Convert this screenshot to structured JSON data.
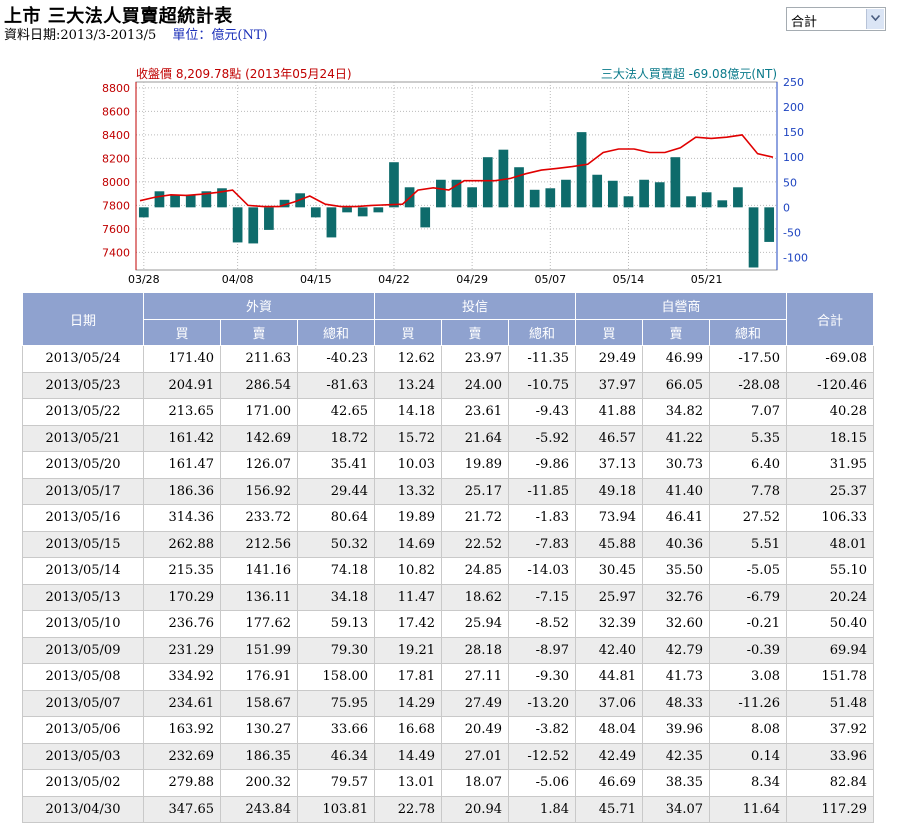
{
  "page": {
    "title": "上市 三大法人買賣超統計表",
    "date_label": "資料日期:2013/3-2013/5",
    "unit_label": "單位：億元(NT)",
    "select_value": "合計"
  },
  "chart_data": {
    "type": "bar+line",
    "price_label": "收盤價 8,209.78點 (2013年05月24日)",
    "net_label": "三大法人買賣超 -69.08億元(NT)",
    "left_ticks": [
      8800,
      8600,
      8400,
      8200,
      8000,
      7800,
      7600,
      7400
    ],
    "right_ticks": [
      250,
      200,
      150,
      100,
      50,
      0,
      -50,
      -100
    ],
    "left_ylim": [
      7250,
      8850
    ],
    "right_ylim": [
      -125,
      250
    ],
    "x_ticks": [
      {
        "label": "03/28",
        "index": 0
      },
      {
        "label": "04/08",
        "index": 6
      },
      {
        "label": "04/15",
        "index": 11
      },
      {
        "label": "04/22",
        "index": 16
      },
      {
        "label": "04/29",
        "index": 21
      },
      {
        "label": "05/07",
        "index": 26
      },
      {
        "label": "05/14",
        "index": 31
      },
      {
        "label": "05/21",
        "index": 36
      }
    ],
    "bars": [
      -20,
      32,
      25,
      25,
      32,
      38,
      -70,
      -72,
      -45,
      15,
      28,
      -20,
      -60,
      -10,
      -18,
      -10,
      90,
      40,
      -40,
      55,
      55,
      40,
      100,
      115,
      80,
      35,
      38,
      55,
      150,
      65,
      53,
      22,
      55,
      50,
      100,
      22,
      30,
      14,
      40,
      -120,
      -69
    ],
    "price": [
      7840,
      7870,
      7890,
      7885,
      7895,
      7910,
      7930,
      7800,
      7790,
      7790,
      7830,
      7880,
      7810,
      7790,
      7790,
      7800,
      7805,
      7810,
      7930,
      7950,
      7930,
      8010,
      8010,
      8010,
      8030,
      8070,
      8100,
      8115,
      8130,
      8150,
      8250,
      8280,
      8280,
      8250,
      8250,
      8290,
      8380,
      8370,
      8380,
      8400,
      8240,
      8210
    ]
  },
  "table": {
    "header_top": [
      "日期",
      "外資",
      "投信",
      "自營商",
      "合計"
    ],
    "header_sub": [
      "買",
      "賣",
      "總和",
      "買",
      "賣",
      "總和",
      "買",
      "賣",
      "總和"
    ],
    "rows": [
      [
        "2013/05/24",
        "171.40",
        "211.63",
        "-40.23",
        "12.62",
        "23.97",
        "-11.35",
        "29.49",
        "46.99",
        "-17.50",
        "-69.08"
      ],
      [
        "2013/05/23",
        "204.91",
        "286.54",
        "-81.63",
        "13.24",
        "24.00",
        "-10.75",
        "37.97",
        "66.05",
        "-28.08",
        "-120.46"
      ],
      [
        "2013/05/22",
        "213.65",
        "171.00",
        "42.65",
        "14.18",
        "23.61",
        "-9.43",
        "41.88",
        "34.82",
        "7.07",
        "40.28"
      ],
      [
        "2013/05/21",
        "161.42",
        "142.69",
        "18.72",
        "15.72",
        "21.64",
        "-5.92",
        "46.57",
        "41.22",
        "5.35",
        "18.15"
      ],
      [
        "2013/05/20",
        "161.47",
        "126.07",
        "35.41",
        "10.03",
        "19.89",
        "-9.86",
        "37.13",
        "30.73",
        "6.40",
        "31.95"
      ],
      [
        "2013/05/17",
        "186.36",
        "156.92",
        "29.44",
        "13.32",
        "25.17",
        "-11.85",
        "49.18",
        "41.40",
        "7.78",
        "25.37"
      ],
      [
        "2013/05/16",
        "314.36",
        "233.72",
        "80.64",
        "19.89",
        "21.72",
        "-1.83",
        "73.94",
        "46.41",
        "27.52",
        "106.33"
      ],
      [
        "2013/05/15",
        "262.88",
        "212.56",
        "50.32",
        "14.69",
        "22.52",
        "-7.83",
        "45.88",
        "40.36",
        "5.51",
        "48.01"
      ],
      [
        "2013/05/14",
        "215.35",
        "141.16",
        "74.18",
        "10.82",
        "24.85",
        "-14.03",
        "30.45",
        "35.50",
        "-5.05",
        "55.10"
      ],
      [
        "2013/05/13",
        "170.29",
        "136.11",
        "34.18",
        "11.47",
        "18.62",
        "-7.15",
        "25.97",
        "32.76",
        "-6.79",
        "20.24"
      ],
      [
        "2013/05/10",
        "236.76",
        "177.62",
        "59.13",
        "17.42",
        "25.94",
        "-8.52",
        "32.39",
        "32.60",
        "-0.21",
        "50.40"
      ],
      [
        "2013/05/09",
        "231.29",
        "151.99",
        "79.30",
        "19.21",
        "28.18",
        "-8.97",
        "42.40",
        "42.79",
        "-0.39",
        "69.94"
      ],
      [
        "2013/05/08",
        "334.92",
        "176.91",
        "158.00",
        "17.81",
        "27.11",
        "-9.30",
        "44.81",
        "41.73",
        "3.08",
        "151.78"
      ],
      [
        "2013/05/07",
        "234.61",
        "158.67",
        "75.95",
        "14.29",
        "27.49",
        "-13.20",
        "37.06",
        "48.33",
        "-11.26",
        "51.48"
      ],
      [
        "2013/05/06",
        "163.92",
        "130.27",
        "33.66",
        "16.68",
        "20.49",
        "-3.82",
        "48.04",
        "39.96",
        "8.08",
        "37.92"
      ],
      [
        "2013/05/03",
        "232.69",
        "186.35",
        "46.34",
        "14.49",
        "27.01",
        "-12.52",
        "42.49",
        "42.35",
        "0.14",
        "33.96"
      ],
      [
        "2013/05/02",
        "279.88",
        "200.32",
        "79.57",
        "13.01",
        "18.07",
        "-5.06",
        "46.69",
        "38.35",
        "8.34",
        "82.84"
      ],
      [
        "2013/04/30",
        "347.65",
        "243.84",
        "103.81",
        "22.78",
        "20.94",
        "1.84",
        "45.71",
        "34.07",
        "11.64",
        "117.29"
      ]
    ]
  },
  "colors": {
    "bar": "#0e6b6b",
    "price_line": "#e00000",
    "price_axis": "#c00000",
    "net_axis": "#1e44c0",
    "header_bg": "#8fa2cf"
  }
}
